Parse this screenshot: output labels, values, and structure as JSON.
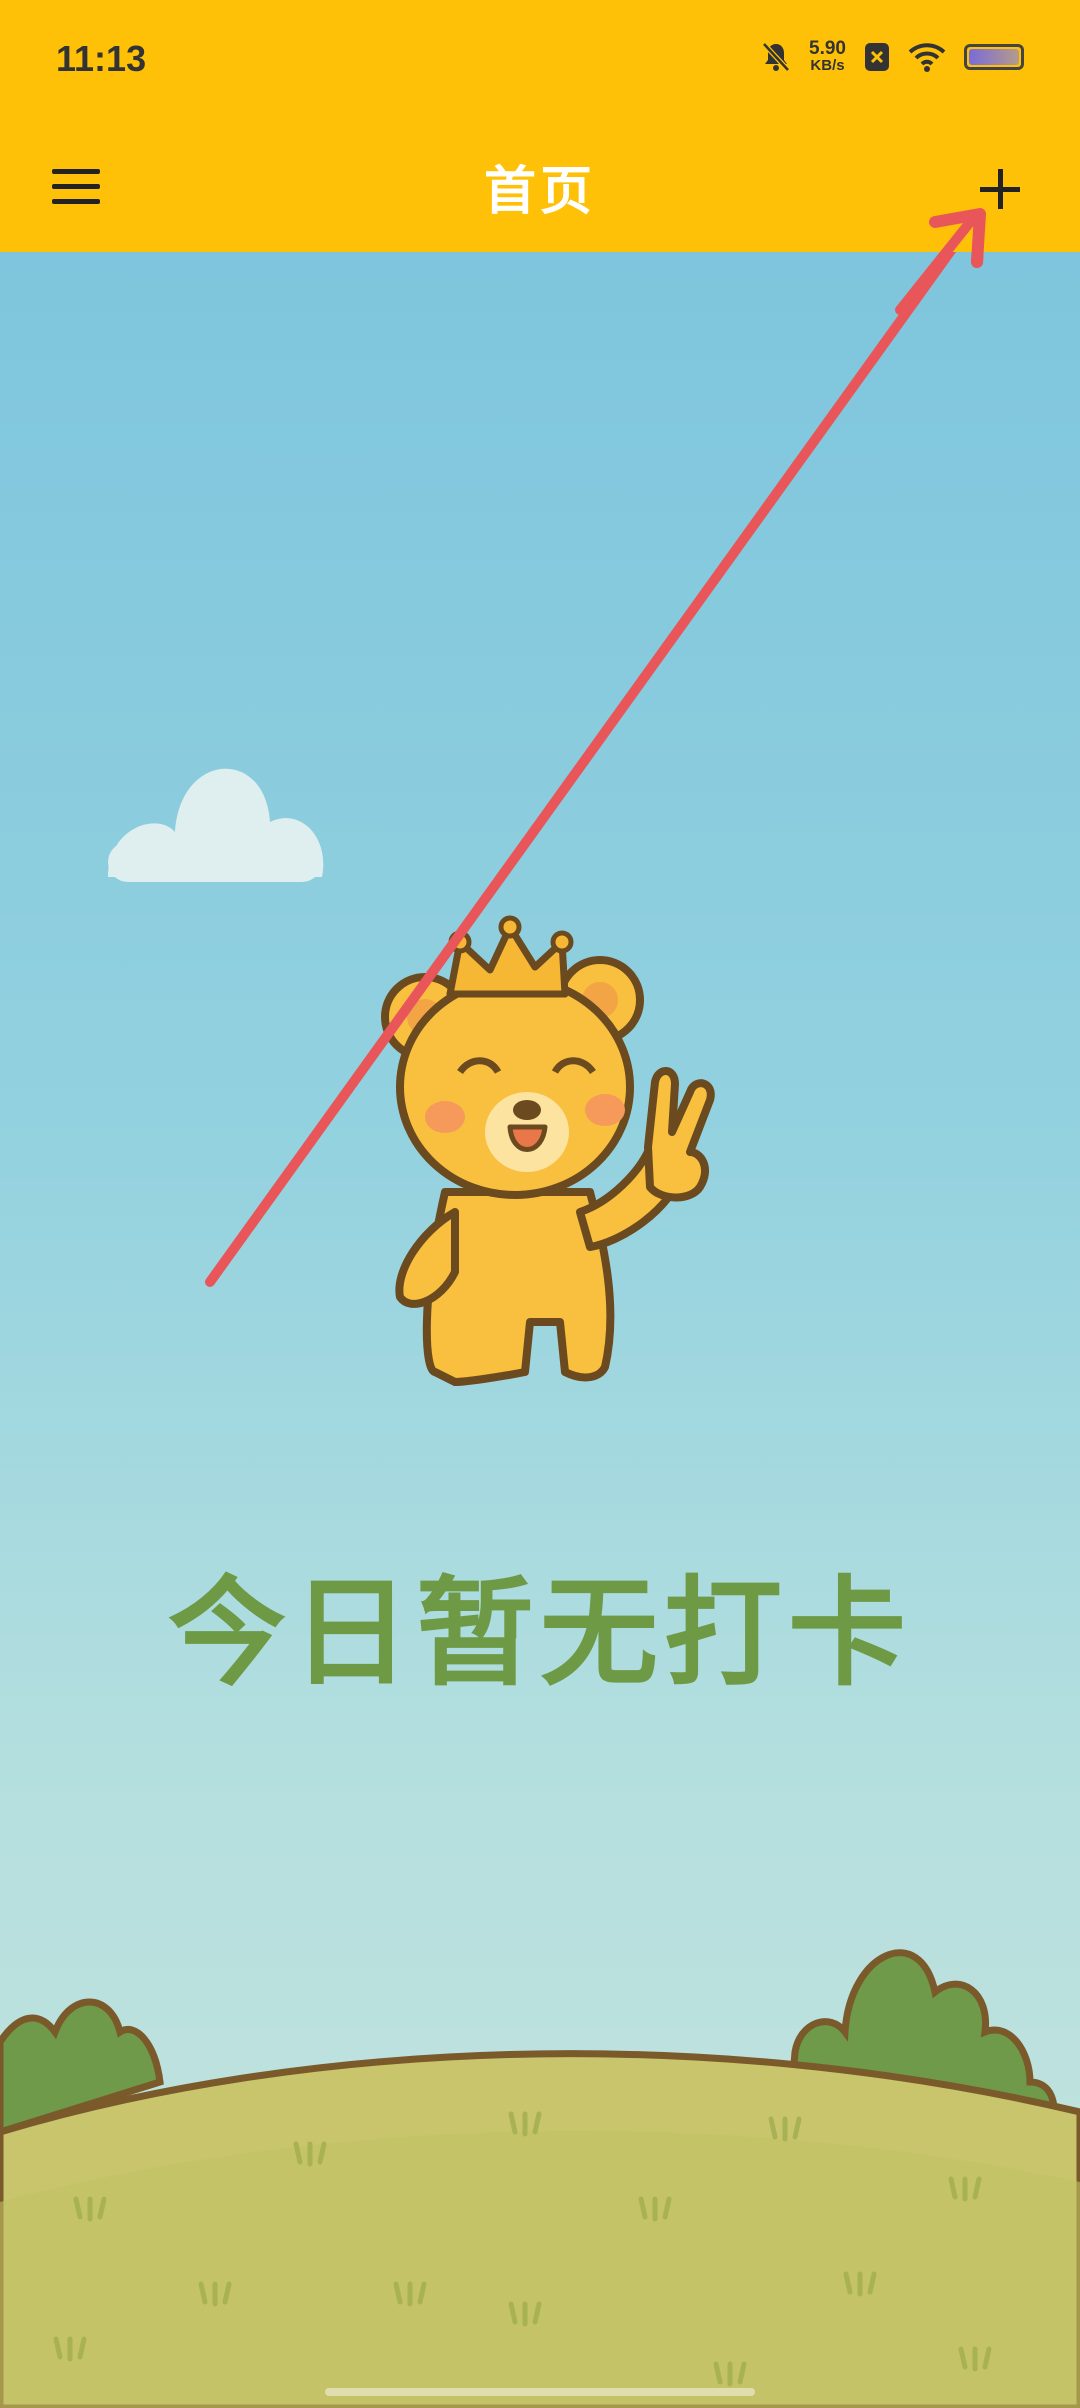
{
  "status_bar": {
    "time": "11:13",
    "net_speed_value": "5.90",
    "net_speed_unit": "KB/s"
  },
  "app_bar": {
    "title": "首页",
    "menu_icon": "hamburger-menu-icon",
    "add_icon": "plus-icon"
  },
  "main": {
    "empty_state_text": "今日暂无打卡",
    "illustration": "bear-with-crown-waving"
  },
  "colors": {
    "app_bar": "#FFC107",
    "empty_text": "#6e9a46",
    "arrow": "#e9565a"
  }
}
